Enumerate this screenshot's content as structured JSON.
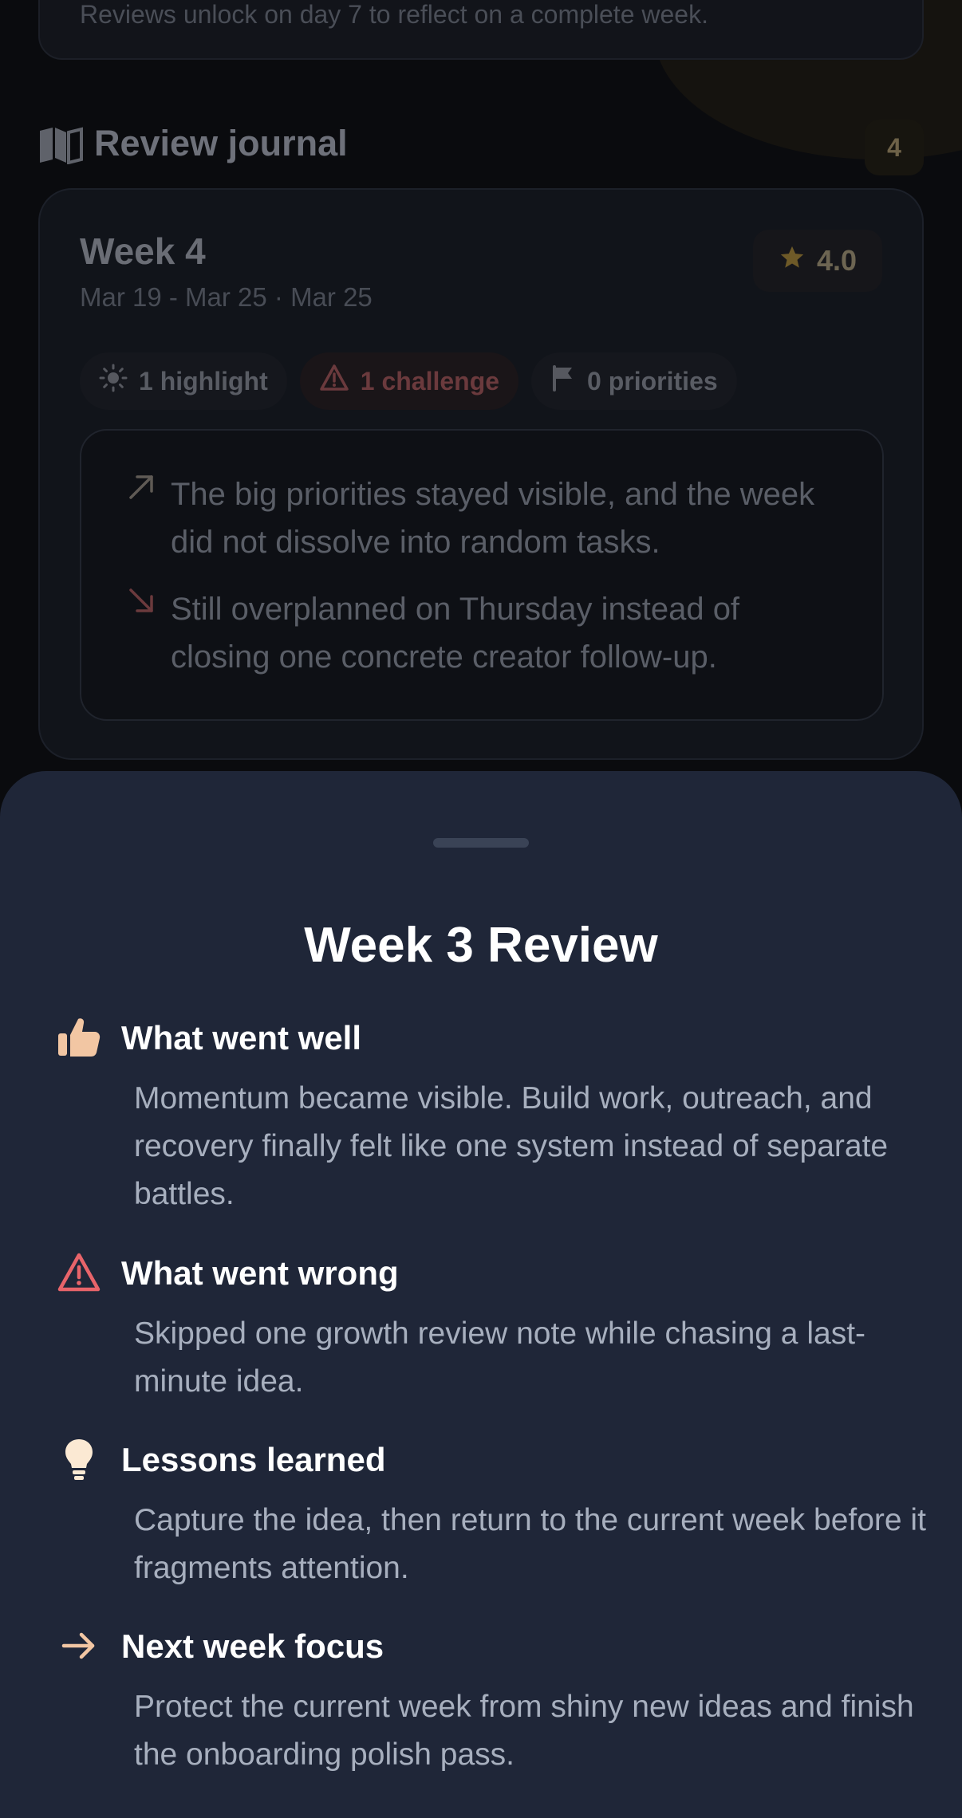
{
  "background": {
    "top_card_text": "Reviews unlock on day 7 to reflect on a complete week.",
    "section_title": "Review journal",
    "section_count": "4",
    "week_card": {
      "title": "Week 4",
      "dates": "Mar 19 - Mar 25 · Mar 25",
      "rating": "4.0",
      "chips": {
        "highlight": "1 highlight",
        "challenge": "1 challenge",
        "priorities": "0 priorities"
      },
      "notes": [
        "The big priorities stayed visible, and the week did not dissolve into random tasks.",
        "Still overplanned on Thursday instead of closing one concrete creator follow-up."
      ]
    }
  },
  "sheet": {
    "title": "Week 3 Review",
    "sections": [
      {
        "icon": "thumbs-up-icon",
        "title": "What went well",
        "body": "Momentum became visible. Build work, outreach, and recovery finally felt like one system instead of separate battles."
      },
      {
        "icon": "warning-icon",
        "title": "What went wrong",
        "body": "Skipped one growth review note while chasing a last-minute idea."
      },
      {
        "icon": "lightbulb-icon",
        "title": "Lessons learned",
        "body": "Capture the idea, then return to the current week before it fragments attention."
      },
      {
        "icon": "arrow-right-icon",
        "title": "Next week focus",
        "body": "Protect the current week from shiny new ideas and finish the onboarding polish pass."
      }
    ]
  },
  "colors": {
    "sheet_bg": "#1f2638",
    "accent_peach": "#f2c6a3",
    "warning_red": "#e8646a",
    "star_gold": "#c89a2e"
  }
}
